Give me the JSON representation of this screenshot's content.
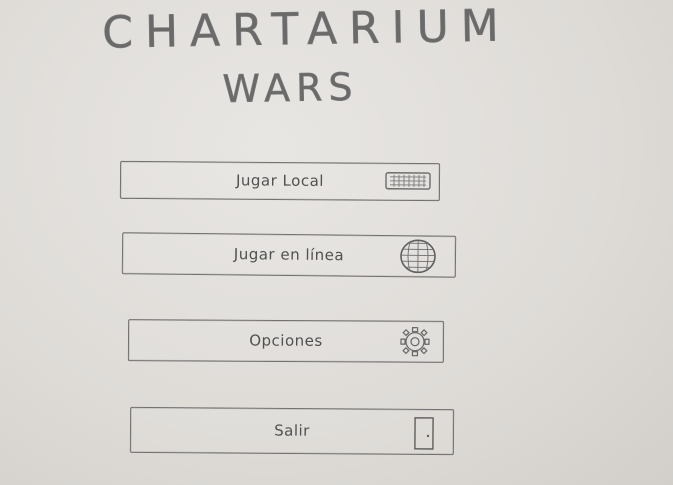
{
  "title": {
    "line1": "CHARTARIUM",
    "line2": "WARS"
  },
  "menu": [
    {
      "label": "Jugar Local",
      "icon": "keyboard-icon"
    },
    {
      "label": "Jugar en línea",
      "icon": "globe-icon"
    },
    {
      "label": "Opciones",
      "icon": "gear-icon"
    },
    {
      "label": "Salir",
      "icon": "door-icon"
    }
  ]
}
